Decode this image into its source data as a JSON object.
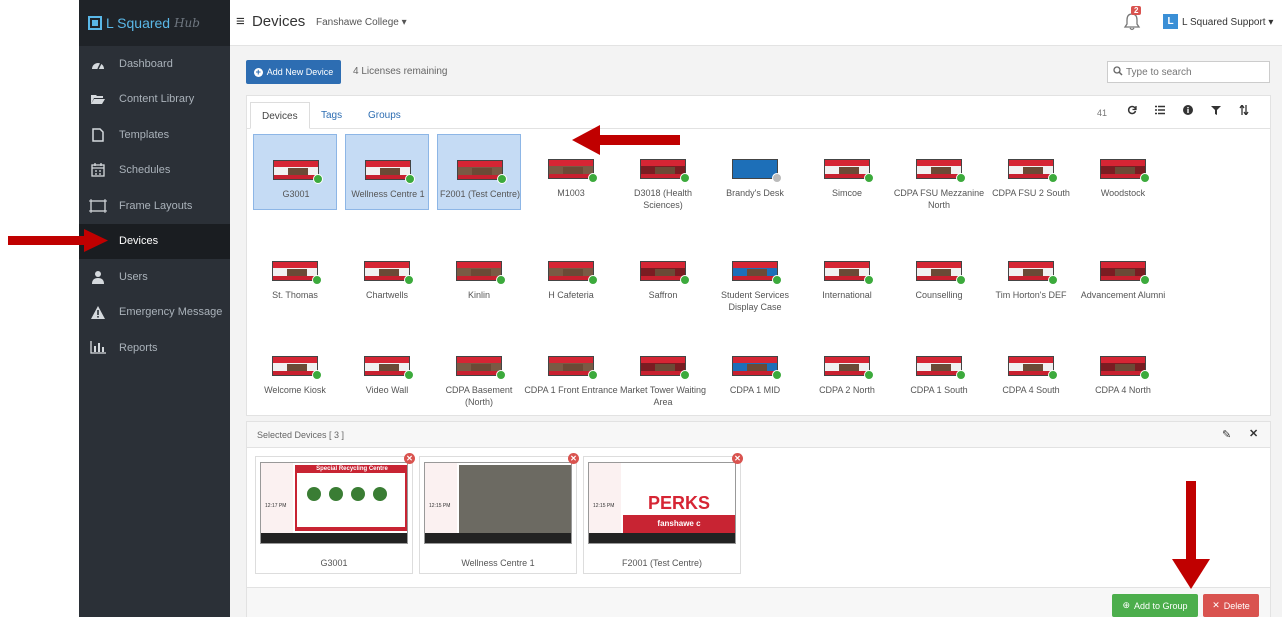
{
  "brand": {
    "name": "L Squared",
    "suffix": "Hub"
  },
  "sidebar": {
    "items": [
      {
        "label": "Dashboard",
        "icon": "dashboard-icon"
      },
      {
        "label": "Content Library",
        "icon": "folder-icon"
      },
      {
        "label": "Templates",
        "icon": "file-icon"
      },
      {
        "label": "Schedules",
        "icon": "calendar-icon"
      },
      {
        "label": "Frame Layouts",
        "icon": "frame-icon"
      },
      {
        "label": "Devices",
        "icon": "monitor-icon",
        "active": true
      },
      {
        "label": "Users",
        "icon": "user-icon"
      },
      {
        "label": "Emergency Message",
        "icon": "warning-icon"
      },
      {
        "label": "Reports",
        "icon": "bar-chart-icon"
      }
    ]
  },
  "header": {
    "title": "Devices",
    "org": "Fanshawe College",
    "notifications": "2",
    "user_initial": "L",
    "user_name": "L Squared Support"
  },
  "toolbar": {
    "add_label": "Add New Device",
    "licenses": "4 Licenses remaining",
    "search_placeholder": "Type to search"
  },
  "tabs": [
    {
      "label": "Devices",
      "active": true
    },
    {
      "label": "Tags"
    },
    {
      "label": "Groups"
    }
  ],
  "device_count": "41",
  "devices": [
    {
      "name": "G3001",
      "selected": true
    },
    {
      "name": "Wellness Centre 1",
      "selected": true
    },
    {
      "name": "F2001 (Test Centre)",
      "selected": true
    },
    {
      "name": "M1003"
    },
    {
      "name": "D3018 (Health Sciences)"
    },
    {
      "name": "Brandy's Desk",
      "status": "offline"
    },
    {
      "name": "Simcoe"
    },
    {
      "name": "CDPA FSU Mezzanine North"
    },
    {
      "name": "CDPA FSU 2 South"
    },
    {
      "name": "Woodstock"
    },
    {
      "name": "St. Thomas"
    },
    {
      "name": "Chartwells"
    },
    {
      "name": "Kinlin"
    },
    {
      "name": "H Cafeteria"
    },
    {
      "name": "Saffron"
    },
    {
      "name": "Student Services Display Case"
    },
    {
      "name": "International"
    },
    {
      "name": "Counselling"
    },
    {
      "name": "Tim Horton's DEF"
    },
    {
      "name": "Advancement Alumni"
    },
    {
      "name": "Welcome Kiosk"
    },
    {
      "name": "Video Wall"
    },
    {
      "name": "CDPA Basement (North)"
    },
    {
      "name": "CDPA 1 Front Entrance"
    },
    {
      "name": "Market Tower Waiting Area"
    },
    {
      "name": "CDPA 1 MID"
    },
    {
      "name": "CDPA 2 North"
    },
    {
      "name": "CDPA 1 South"
    },
    {
      "name": "CDPA 4 South"
    },
    {
      "name": "CDPA 4 North"
    }
  ],
  "selected": {
    "title": "Selected Devices [ 3 ]",
    "items": [
      {
        "name": "G3001",
        "heading": "Special Recycling Centre",
        "time": "12:17 PM"
      },
      {
        "name": "Wellness Centre 1",
        "time": "12:15 PM"
      },
      {
        "name": "F2001 (Test Centre)",
        "heading": "PERKS",
        "sub": "fanshawe c",
        "time": "12:15 PM"
      }
    ]
  },
  "actions": {
    "add_group": "Add to Group",
    "delete": "Delete"
  },
  "colors": {
    "sidebar": "#2b3037",
    "primary": "#2d6db2",
    "success": "#4cae4c",
    "danger": "#d9534f",
    "annotation_arrow": "#c00000"
  }
}
